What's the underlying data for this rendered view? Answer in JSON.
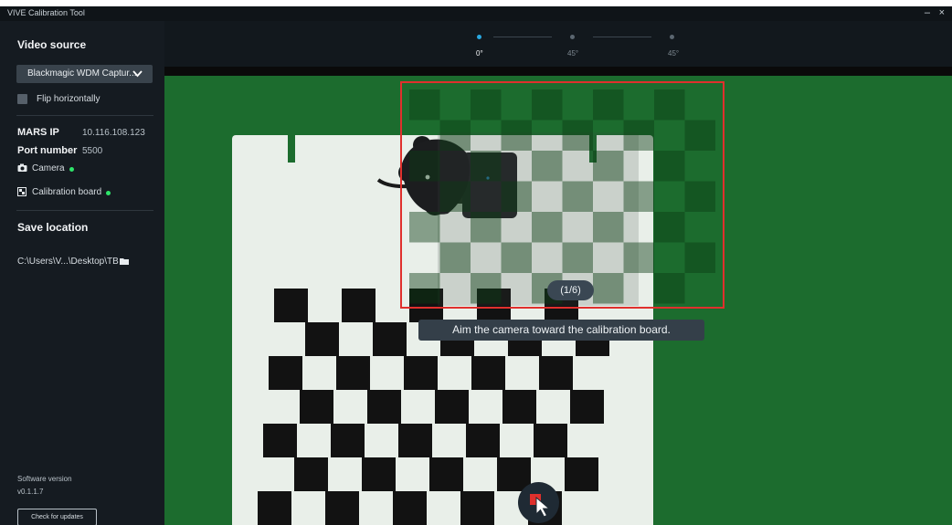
{
  "window": {
    "title": "VIVE Calibration Tool",
    "minimize_glyph": "–",
    "close_glyph": "×"
  },
  "sidebar": {
    "video_source_heading": "Video source",
    "video_source_value": "Blackmagic WDM Captur...",
    "flip_label": "Flip horizontally",
    "mars_ip_label": "MARS IP",
    "mars_ip_value": "10.116.108.123",
    "port_label": "Port number",
    "port_value": "5500",
    "camera_label": "Camera",
    "calibration_board_label": "Calibration board",
    "save_location_heading": "Save location",
    "save_location_path": "C:\\Users\\V...\\Desktop\\TB",
    "software_version_label": "Software version",
    "software_version_value": "v0.1.1.7",
    "check_updates_label": "Check for updates"
  },
  "stepper": {
    "steps": [
      {
        "label": "0°",
        "active": true
      },
      {
        "label": "45°",
        "active": false
      },
      {
        "label": "45°",
        "active": false
      }
    ],
    "active_color": "#29a8e0",
    "inactive_color": "#5b6670"
  },
  "video": {
    "capture_counter": "(1/6)",
    "instruction": "Aim the camera toward the calibration board."
  },
  "colors": {
    "status_ok": "#2ee56a",
    "frame_outline": "#e0302d",
    "cursor_accent": "#e0302d"
  },
  "icons": [
    "chevron-down-icon",
    "camera-icon",
    "checkerboard-icon",
    "folder-icon",
    "cursor-icon"
  ]
}
